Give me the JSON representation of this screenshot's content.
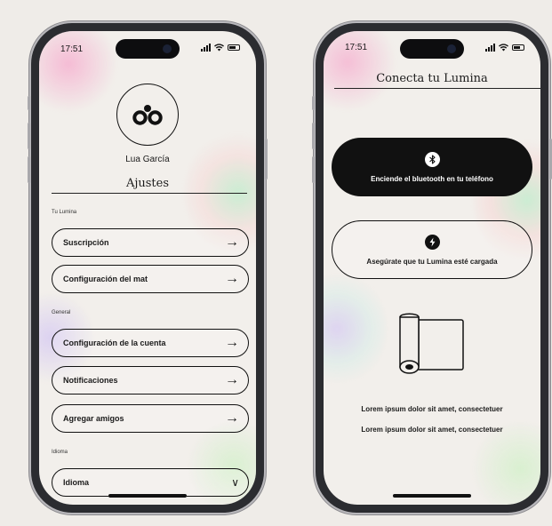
{
  "status_bar": {
    "time": "17:51"
  },
  "settings_screen": {
    "user_name": "Lua García",
    "title": "Ajustes",
    "sections": [
      {
        "label": "Tu Lumina",
        "items": [
          "Suscripción",
          "Configuración del mat"
        ]
      },
      {
        "label": "General",
        "items": [
          "Configuración de la cuenta",
          "Notificaciones",
          "Agregar amigos"
        ]
      },
      {
        "label": "Idioma",
        "items": [
          "Idioma"
        ]
      }
    ],
    "arrow_glyph": "→",
    "dropdown_glyph": "∨"
  },
  "connect_screen": {
    "title": "Conecta tu Lumina",
    "bluetooth_card": {
      "text": "Enciende el bluetooth en tu teléfono",
      "icon": "bluetooth-icon"
    },
    "charge_card": {
      "text": "Asegúrate que tu Lumina esté cargada",
      "icon": "lightning-icon"
    },
    "illustration": "mat-roll-icon",
    "body_lines": [
      "Lorem ipsum dolor sit amet, consectetuer",
      "Lorem ipsum dolor sit amet, consectetuer"
    ]
  },
  "colors": {
    "background": "#efece8",
    "screen": "#f2efeb",
    "ink": "#111111",
    "frame": "#2b2c30"
  }
}
